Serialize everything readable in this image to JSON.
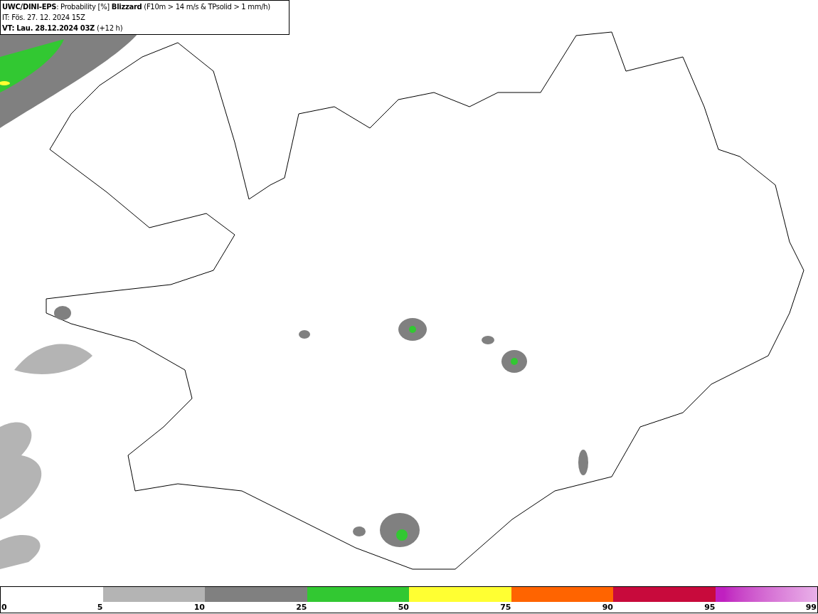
{
  "header": {
    "lines": [
      "**UWC/DINI-EPS**: Probability [%] **Blizzard** (F10m > 14 m/s & TPsolid > 1 mm/h)",
      "IT: Fös. 27. 12. 2024 15Z",
      "**VT: Lau. 28.12.2024 03Z** (+12 h)"
    ]
  },
  "legend": {
    "segments": [
      {
        "color": "#b4b4b4"
      },
      {
        "color": "#808080"
      },
      {
        "color": "#32c832"
      },
      {
        "color": "#ffff32"
      },
      {
        "color": "#ff6400"
      },
      {
        "color": "#c80a3c"
      },
      {
        "color": "#c020c0",
        "kind": "gradient"
      }
    ],
    "ticks": [
      "0",
      "5",
      "10",
      "25",
      "50",
      "75",
      "90",
      "95",
      "99"
    ]
  }
}
